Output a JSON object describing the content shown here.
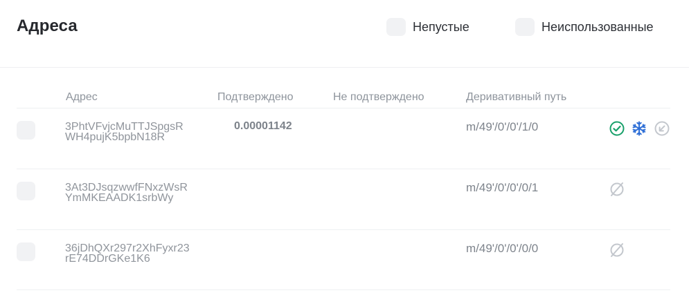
{
  "header": {
    "title": "Адреса",
    "filters": [
      {
        "label": "Непустые",
        "checked": false
      },
      {
        "label": "Неиспользованные",
        "checked": false
      }
    ]
  },
  "table": {
    "columns": [
      "Адрес",
      "Подтверждено",
      "Не подтверждено",
      "Деривативный путь"
    ],
    "rows": [
      {
        "address": "3PhtVFvjcMuTTJSpgsRWH4pujK5bpbN18R",
        "confirmed": "0.00001142",
        "unconfirmed": "",
        "path": "m/49'/0'/0'/1/0",
        "icons": [
          "check-circle-icon",
          "snowflake-icon",
          "receive-arrow-icon"
        ]
      },
      {
        "address": "3At3DJsqzwwfFNxzWsRYmMKEAADK1srbWy",
        "confirmed": "",
        "unconfirmed": "",
        "path": "m/49'/0'/0'/0/1",
        "icons": [
          "empty-set-icon"
        ]
      },
      {
        "address": "36jDhQXr297r2XhFyxr23rE74DDrGKe1K6",
        "confirmed": "",
        "unconfirmed": "",
        "path": "m/49'/0'/0'/0/0",
        "icons": [
          "empty-set-icon"
        ]
      }
    ]
  },
  "colors": {
    "check": "#18a06a",
    "snowflake": "#2f6fd6",
    "muted_icon": "#c3c7cd"
  }
}
